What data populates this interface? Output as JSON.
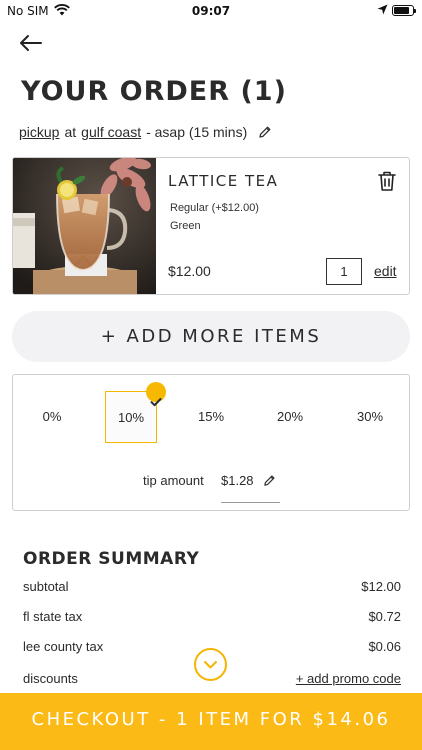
{
  "status_bar": {
    "carrier": "No SIM",
    "time": "09:07",
    "battery_level": 0.85
  },
  "page": {
    "title": "YOUR ORDER (1)"
  },
  "fulfillment": {
    "method": "pickup",
    "connector": "at",
    "location": "gulf coast",
    "timing": "- asap (15 mins)"
  },
  "items": [
    {
      "name": "LATTICE TEA",
      "options": [
        "Regular (+$12.00)",
        "Green"
      ],
      "price": "$12.00",
      "quantity": "1",
      "edit_label": "edit"
    }
  ],
  "add_more_label": "+ ADD MORE ITEMS",
  "tip": {
    "options": [
      "0%",
      "10%",
      "15%",
      "20%",
      "30%"
    ],
    "selected": "10%",
    "amount_label": "tip amount",
    "amount_value": "$1.28"
  },
  "summary": {
    "title": "ORDER SUMMARY",
    "rows": [
      {
        "label": "subtotal",
        "value": "$12.00"
      },
      {
        "label": "fl state tax",
        "value": "$0.72"
      },
      {
        "label": "lee county tax",
        "value": "$0.06"
      },
      {
        "label": "discounts",
        "value": "+ add promo code"
      }
    ]
  },
  "checkout_label": "CHECKOUT - 1 ITEM FOR $14.06",
  "colors": {
    "accent": "#fbba16",
    "selected_border": "#f2b500",
    "add_more_bg": "#f2f2f5"
  },
  "icons": [
    "back-arrow-icon",
    "pencil-icon",
    "trash-icon",
    "checkmark-icon",
    "chevron-down-icon",
    "wifi-icon",
    "location-arrow-icon",
    "battery-icon"
  ]
}
